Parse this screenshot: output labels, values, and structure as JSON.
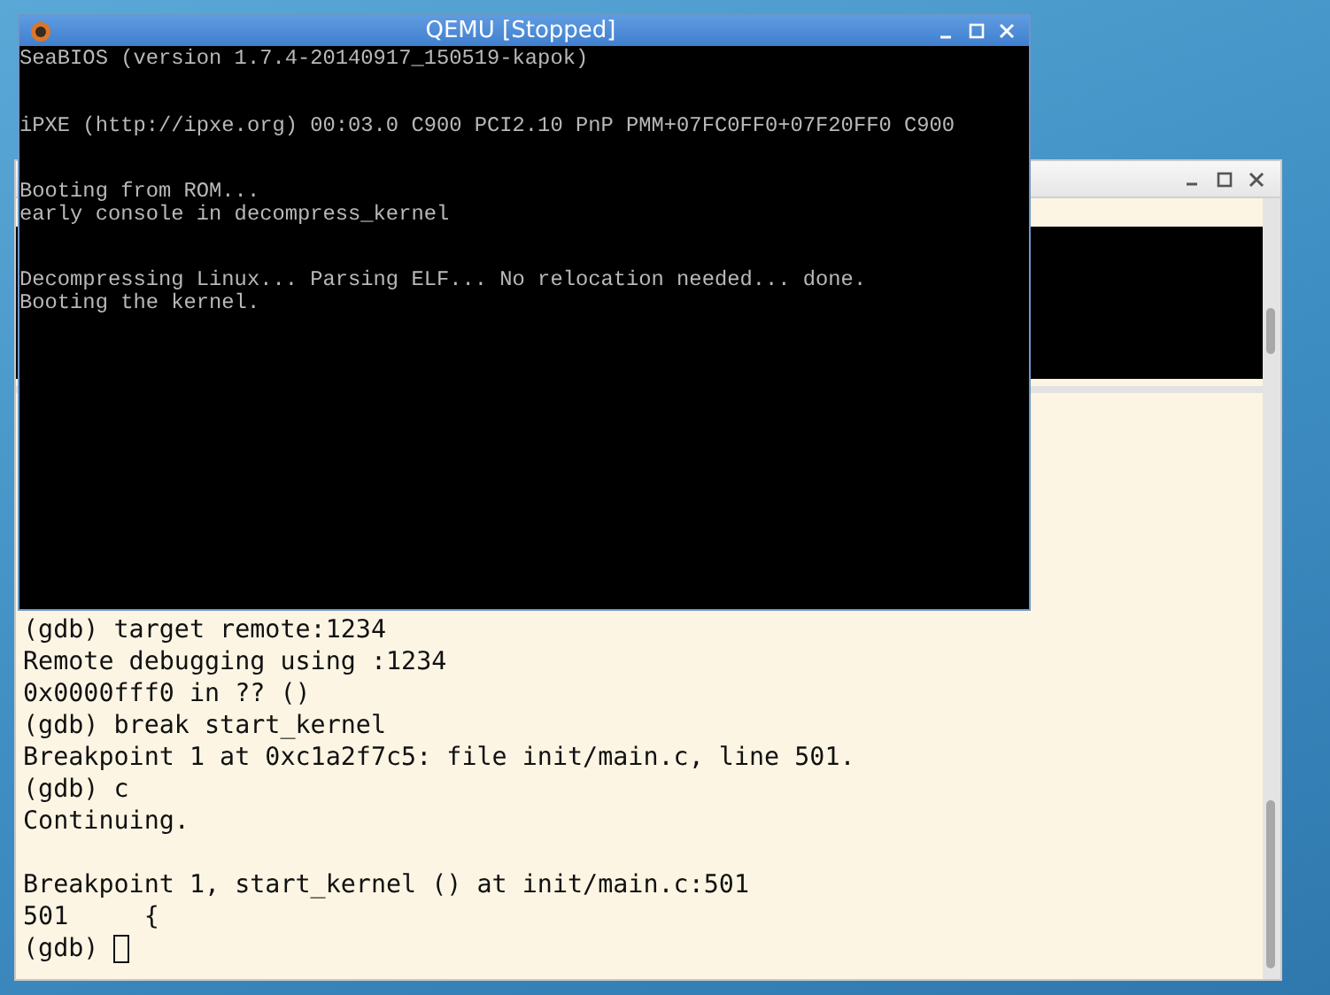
{
  "qemu_window": {
    "title": "QEMU [Stopped]",
    "console_blocks": [
      [
        "SeaBIOS (version 1.7.4-20140917_150519-kapok)"
      ],
      [
        "iPXE (http://ipxe.org) 00:03.0 C900 PCI2.10 PnP PMM+07FC0FF0+07F20FF0 C900"
      ],
      [
        "Booting from ROM...",
        "early console in decompress_kernel"
      ],
      [
        "Decompressing Linux... Parsing ELF... No relocation needed... done.",
        "Booting the kernel."
      ]
    ]
  },
  "terminal_window": {
    "blocks": [
      [
        "(gdb) target remote:1234",
        "Remote debugging using :1234",
        "0x0000fff0 in ?? ()",
        "(gdb) break start_kernel",
        "Breakpoint 1 at 0xc1a2f7c5: file init/main.c, line 501.",
        "(gdb) c",
        "Continuing."
      ],
      [
        "Breakpoint 1, start_kernel () at init/main.c:501",
        "501     {"
      ]
    ],
    "prompt": "(gdb)"
  }
}
